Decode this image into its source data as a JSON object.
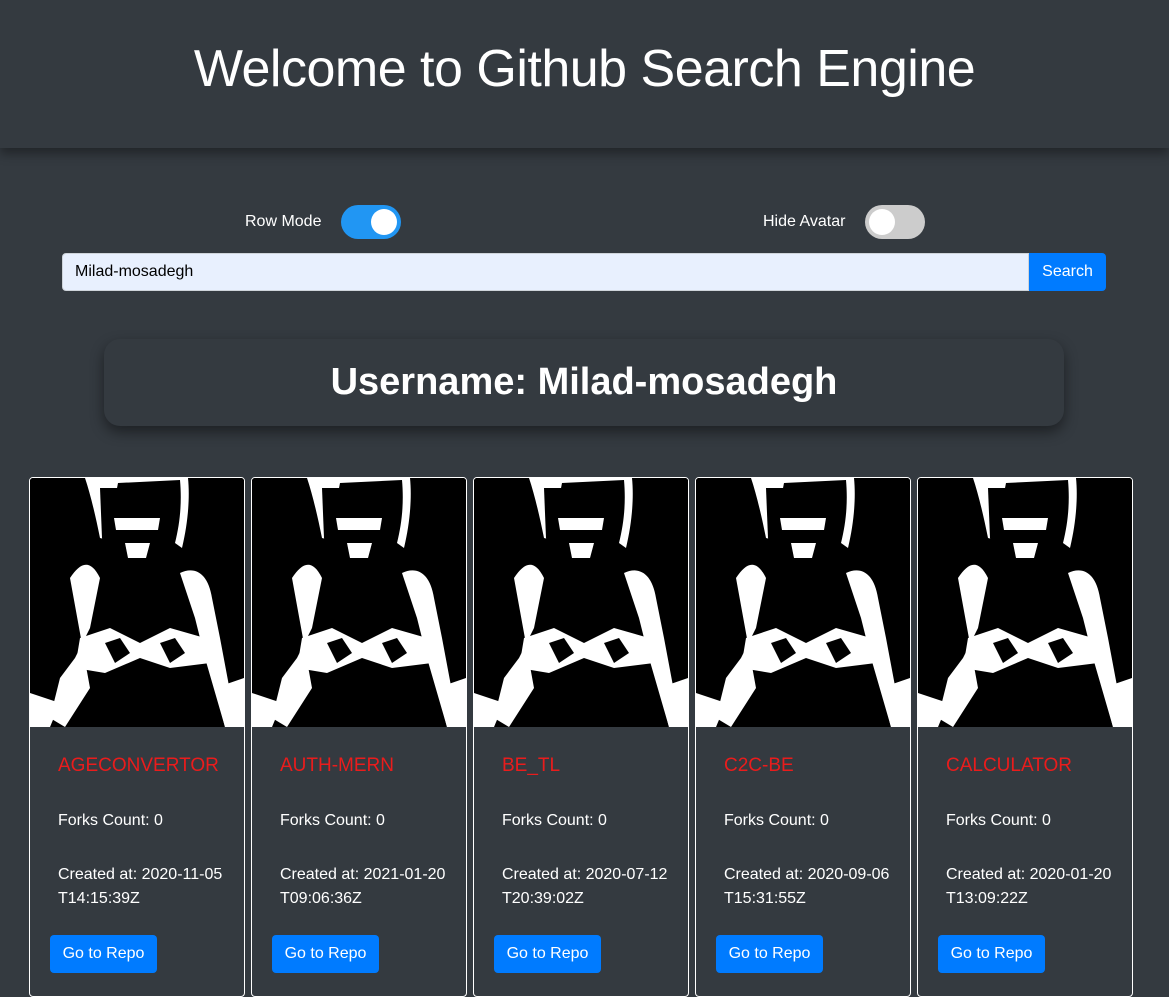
{
  "header": {
    "title": "Welcome to Github Search Engine"
  },
  "controls": {
    "row_mode_label": "Row Mode",
    "row_mode_on": true,
    "hide_avatar_label": "Hide Avatar",
    "hide_avatar_on": false
  },
  "search": {
    "value": "Milad-mosadegh",
    "button_label": "Search"
  },
  "user": {
    "username_text": "Username: Milad-mosadegh"
  },
  "repos": [
    {
      "name": "AGECONVERTOR",
      "forks": "Forks Count: 0",
      "created": "Created at: 2020-11-05T14:15:39Z",
      "button": "Go to Repo"
    },
    {
      "name": "AUTH-MERN",
      "forks": "Forks Count: 0",
      "created": "Created at: 2021-01-20T09:06:36Z",
      "button": "Go to Repo"
    },
    {
      "name": "BE_TL",
      "forks": "Forks Count: 0",
      "created": "Created at: 2020-07-12T20:39:02Z",
      "button": "Go to Repo"
    },
    {
      "name": "C2C-BE",
      "forks": "Forks Count: 0",
      "created": "Created at: 2020-09-06T15:31:55Z",
      "button": "Go to Repo"
    },
    {
      "name": "CALCULATOR",
      "forks": "Forks Count: 0",
      "created": "Created at: 2020-01-20T13:09:22Z",
      "button": "Go to Repo"
    }
  ],
  "colors": {
    "background": "#343a40",
    "accent": "#007bff",
    "toggle_on": "#2196f3",
    "repo_name": "#ea1c1c"
  }
}
